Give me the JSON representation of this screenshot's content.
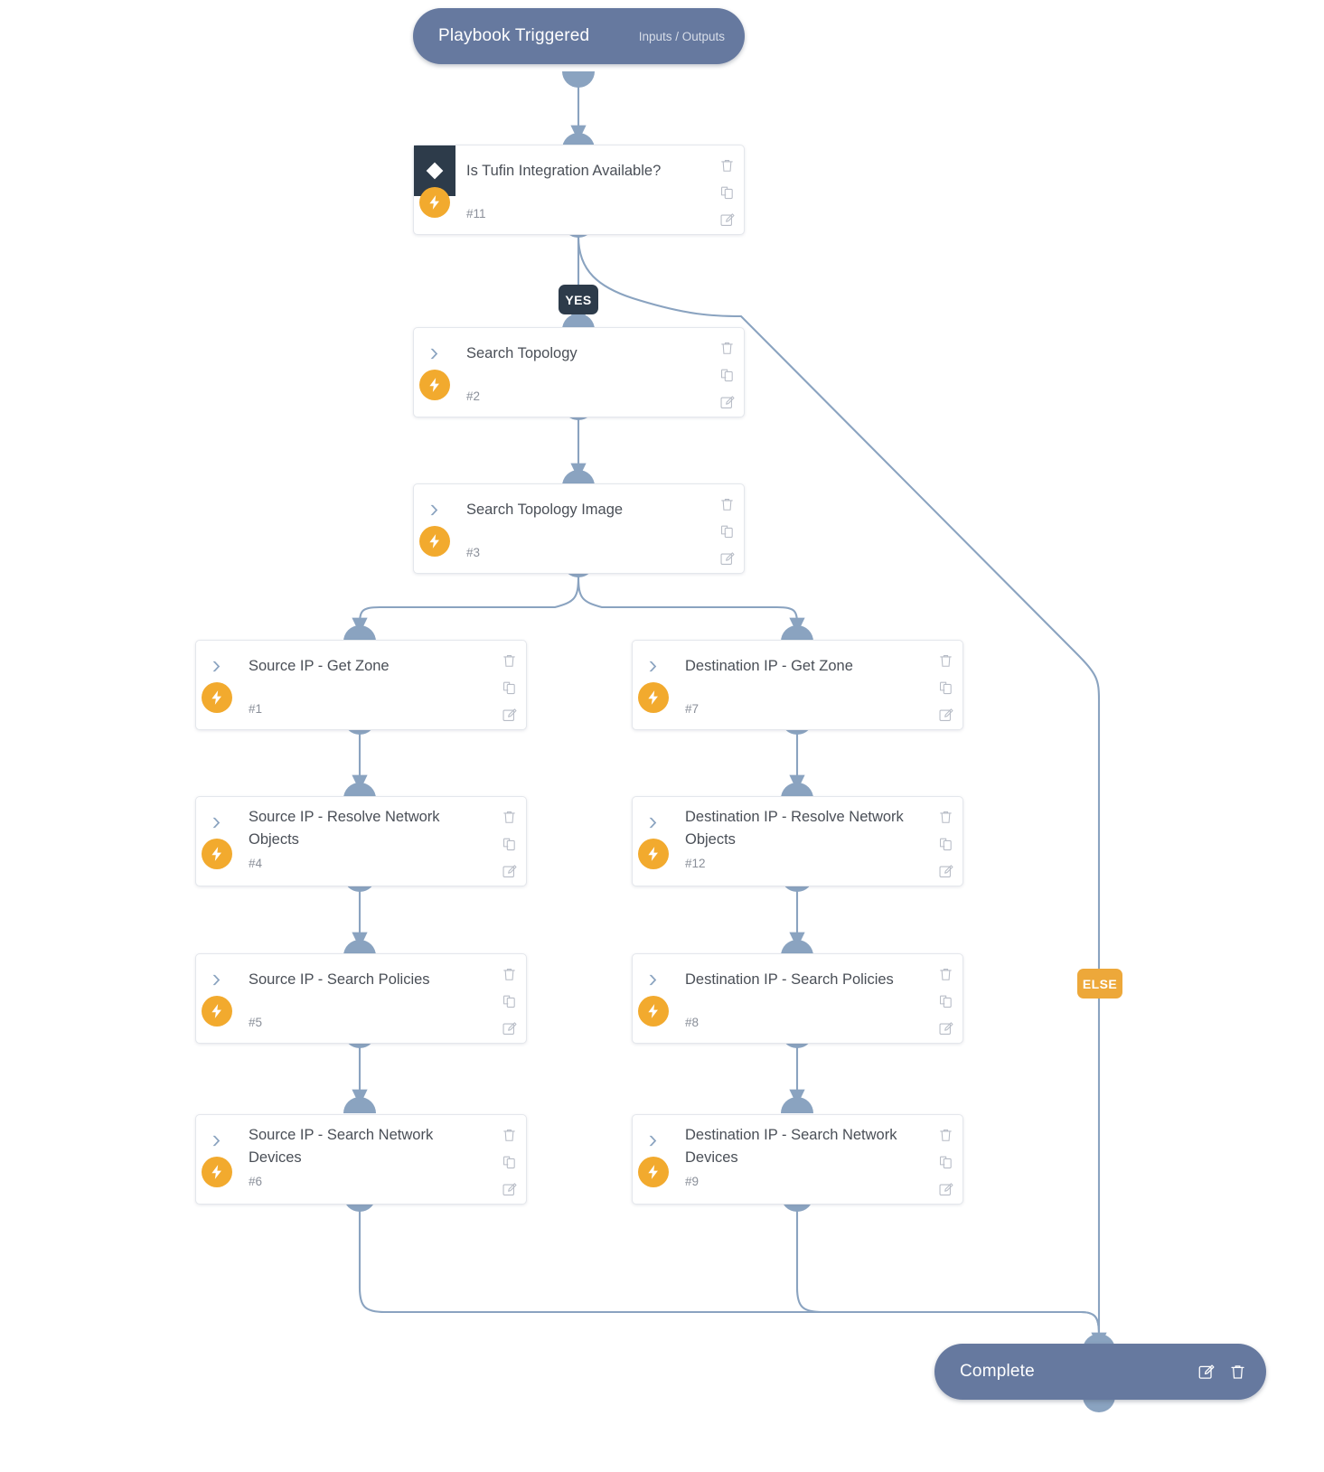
{
  "theme": {
    "edge_color": "#8aa3c0",
    "pill_bg": "#66799f",
    "decision_icon_bg": "#2d3b4a",
    "bolt_bg": "#f2aa2e",
    "else_badge_bg": "#eda83a",
    "yes_badge_bg": "#2d3b4a",
    "card_border": "#e4e7ec",
    "title_color": "#4a4f57",
    "num_color": "#8a8f99"
  },
  "start": {
    "label": "Playbook Triggered",
    "sub_label": "Inputs / Outputs",
    "name": "playbook-triggered-node"
  },
  "end": {
    "label": "Complete",
    "name": "complete-node",
    "actions": [
      "edit-icon",
      "delete-icon"
    ]
  },
  "badges": {
    "yes": "YES",
    "else": "ELSE"
  },
  "card_actions": [
    "delete-icon",
    "duplicate-icon",
    "edit-icon"
  ],
  "nodes": [
    {
      "id": "n11",
      "title": "Is Tufin Integration Available?",
      "number": "#11",
      "type": "decision",
      "icon": "diamond-icon",
      "two_line": false
    },
    {
      "id": "n2",
      "title": "Search Topology",
      "number": "#2",
      "type": "task",
      "icon": "chevron-right-icon",
      "two_line": false
    },
    {
      "id": "n3",
      "title": "Search Topology Image",
      "number": "#3",
      "type": "task",
      "icon": "chevron-right-icon",
      "two_line": false
    },
    {
      "id": "n1",
      "title": "Source IP - Get Zone",
      "number": "#1",
      "type": "task",
      "icon": "chevron-right-icon",
      "two_line": false
    },
    {
      "id": "n7",
      "title": "Destination IP - Get Zone",
      "number": "#7",
      "type": "task",
      "icon": "chevron-right-icon",
      "two_line": false
    },
    {
      "id": "n4",
      "title": "Source IP - Resolve Network Objects",
      "number": "#4",
      "type": "task",
      "icon": "chevron-right-icon",
      "two_line": true
    },
    {
      "id": "n12",
      "title": "Destination IP - Resolve Network Objects",
      "number": "#12",
      "type": "task",
      "icon": "chevron-right-icon",
      "two_line": true
    },
    {
      "id": "n5",
      "title": "Source IP - Search Policies",
      "number": "#5",
      "type": "task",
      "icon": "chevron-right-icon",
      "two_line": false
    },
    {
      "id": "n8",
      "title": "Destination IP - Search Policies",
      "number": "#8",
      "type": "task",
      "icon": "chevron-right-icon",
      "two_line": false
    },
    {
      "id": "n6",
      "title": "Source IP - Search Network Devices",
      "number": "#6",
      "type": "task",
      "icon": "chevron-right-icon",
      "two_line": true
    },
    {
      "id": "n9",
      "title": "Destination IP - Search Network Devices",
      "number": "#9",
      "type": "task",
      "icon": "chevron-right-icon",
      "two_line": true
    }
  ]
}
